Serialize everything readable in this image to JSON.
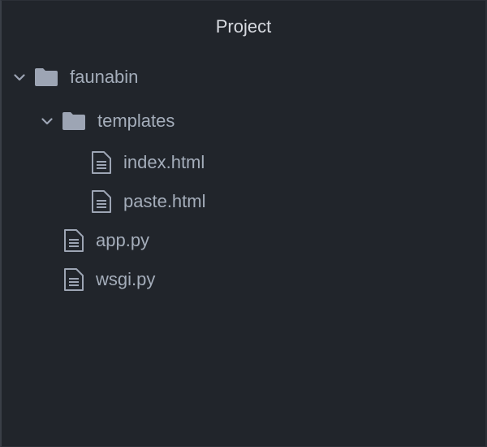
{
  "panel": {
    "title": "Project"
  },
  "tree": {
    "root": {
      "label": "faunabin",
      "icon": "folder-icon",
      "expanded": true
    },
    "templates": {
      "label": "templates",
      "icon": "folder-icon",
      "expanded": true
    },
    "files": [
      {
        "label": "index.html",
        "icon": "file-icon"
      },
      {
        "label": "paste.html",
        "icon": "file-icon"
      },
      {
        "label": "app.py",
        "icon": "file-icon"
      },
      {
        "label": "wsgi.py",
        "icon": "file-icon"
      }
    ]
  },
  "colors": {
    "background": "#21252b",
    "text": "#a4adba",
    "title": "#d7dae0",
    "icon": "#9da5b4"
  }
}
